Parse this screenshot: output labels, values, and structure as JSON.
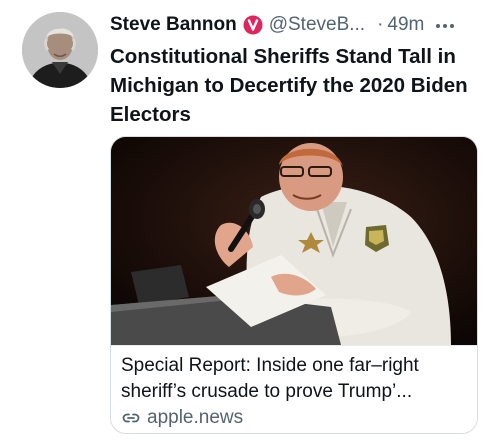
{
  "tweet": {
    "author_name": "Steve Bannon",
    "author_handle": "@SteveB...",
    "separator": "·",
    "timestamp": "49m",
    "verified": true,
    "text": "Constitutional Sheriffs Stand Tall in Michigan to Decertify the 2020 Biden Electors"
  },
  "card": {
    "title": "Special Report: Inside one far–right sheriff’s crusade to prove Trump’...",
    "domain": "apple.news"
  },
  "colors": {
    "verified_badge": "#e0245e",
    "secondary_text": "#536471",
    "primary_text": "#0f1419"
  },
  "icons": {
    "verified": "verified-badge-icon",
    "more": "more-options-icon",
    "link": "link-icon"
  }
}
